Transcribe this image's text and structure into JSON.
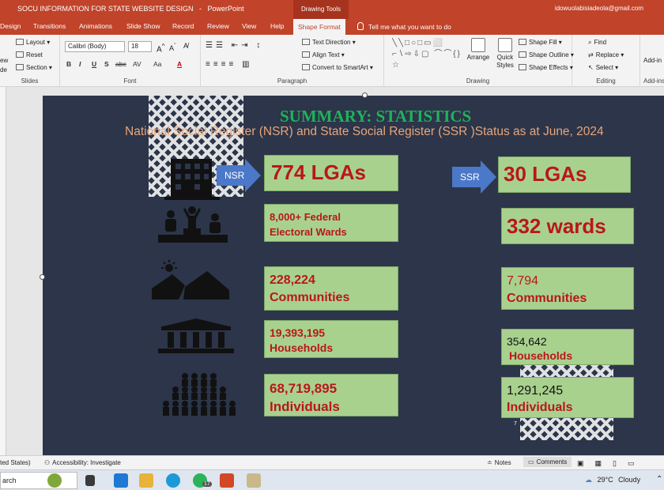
{
  "window": {
    "doc_title": "SOCU INFORMATION FOR STATE WEBSITE DESIGN",
    "separator": "-",
    "app_name": "PowerPoint",
    "context_tab": "Drawing Tools",
    "account": "idowuolabisiadeola@gmail.com"
  },
  "tabs": [
    "Design",
    "Transitions",
    "Animations",
    "Slide Show",
    "Record",
    "Review",
    "View",
    "Help",
    "Shape Format"
  ],
  "tell_me": "Tell me what you want to do",
  "ribbon": {
    "slides": {
      "label": "Slides",
      "new_slide_top": "ew",
      "new_slide_bottom": "de",
      "layout": "Layout",
      "reset": "Reset",
      "section": "Section"
    },
    "font": {
      "label": "Font",
      "family": "Calibri (Body)",
      "size": "18",
      "bold": "B",
      "italic": "I",
      "underline": "U",
      "shadow": "S",
      "strike": "abc",
      "spacing": "AV",
      "case": "Aa",
      "color": "A"
    },
    "paragraph": {
      "label": "Paragraph",
      "text_direction": "Text Direction",
      "align_text": "Align Text",
      "smartart": "Convert to SmartArt"
    },
    "drawing": {
      "label": "Drawing",
      "shapes_preview": "╲╲□○□▭⬜ ⌐∖⇨⇩▢ ⌒⌒{}☆",
      "arrange": "Arrange",
      "quick_styles_1": "Quick",
      "quick_styles_2": "Styles",
      "shape_fill": "Shape Fill",
      "shape_outline": "Shape Outline",
      "shape_effects": "Shape Effects"
    },
    "editing": {
      "label": "Editing",
      "find": "Find",
      "replace": "Replace",
      "select": "Select"
    },
    "addins": {
      "label": "Add-ins",
      "button": "Add-in"
    }
  },
  "slide": {
    "title": "SUMMARY: STATISTICS",
    "subtitle": "National Social Register (NSR) and State Social Register (SSR )Status as at June, 2024",
    "nsr_label": "NSR",
    "ssr_label": "SSR",
    "nsr": {
      "lgas": "774 LGAs",
      "wards_line1": "8,000+ Federal",
      "wards_line2": "Electoral Wards",
      "communities_value": "228,224",
      "communities_label": "Communities",
      "households_value": "19,393,195",
      "households_label": "Households",
      "individuals_value": "68,719,895",
      "individuals_label": "Individuals"
    },
    "ssr": {
      "lgas": "30 LGAs",
      "wards": "332 wards",
      "communities_value": "7,794",
      "communities_label": "Communities",
      "households_value": "354,642",
      "households_label": "Households",
      "individuals_value": "1,291,245",
      "individuals_label": "Individuals"
    },
    "page_mark": "7"
  },
  "statusbar": {
    "state": "ted States)",
    "accessibility": "Accessibility: Investigate",
    "notes": "Notes",
    "comments": "Comments"
  },
  "taskbar": {
    "search": "arch",
    "notification_count": "17",
    "weather_temp": "29°C",
    "weather_desc": "Cloudy"
  }
}
